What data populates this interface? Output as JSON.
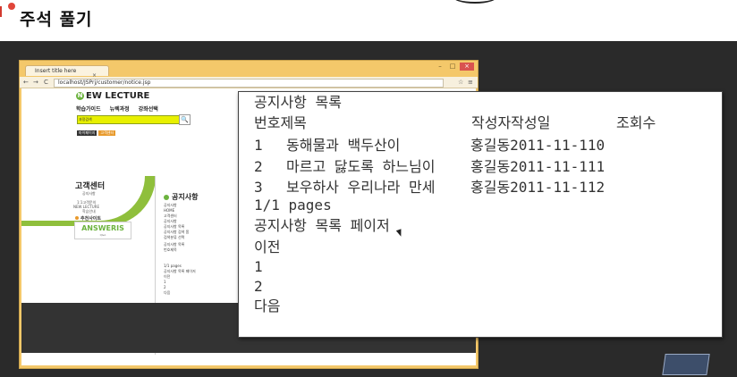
{
  "slide": {
    "title": "주석 풀기"
  },
  "browser": {
    "tab_title": "Insert title here",
    "tab_close": "×",
    "url": "localhost/JSPrj/customer/notice.jsp",
    "window_buttons": [
      "–",
      "□",
      "×"
    ],
    "nav_icons": [
      "←",
      "→",
      "C"
    ],
    "tool_icons": [
      "☆",
      "≡"
    ]
  },
  "site": {
    "logo_letter": "N",
    "logo_text": "EW LECTURE",
    "nav": [
      "학습가이드",
      "뉴렉과정",
      "강좌선택"
    ],
    "search_label": "과정검색",
    "search_icon": "🔍",
    "mini_buttons": [
      "마이페이지",
      "고객센터"
    ],
    "sidebar_title": "고객센터",
    "sidebar_links": [
      "공지사항",
      "1:1고객문의",
      "NEW LECTURE",
      "학습안내"
    ],
    "recommended": "추천사이트",
    "partner_logo": "ANSWERIS",
    "notice_heading": "공지사항",
    "small_lines": [
      "공지사항",
      "HOME",
      "고객센터",
      "공지사항",
      "공지사항 목록",
      "공지사항 검색 폼",
      "검색분류 선택",
      "공지사항 목록",
      "번호제목",
      "1/1 pages",
      "공지사항 목록 페이저",
      "이전",
      "1",
      "2",
      "다음"
    ]
  },
  "popup": {
    "title": "공지사항 목록",
    "header": {
      "num_title": "번호제목",
      "author_date": "작성자작성일",
      "views": "조회수"
    },
    "rows": [
      {
        "num": "1",
        "title": "동해물과 백두산이",
        "author_date": "홍길동2011-11-110"
      },
      {
        "num": "2",
        "title": "마르고 닳도록 하느님이",
        "author_date": "홍길동2011-11-111"
      },
      {
        "num": "3",
        "title": "보우하사 우리나라 만세",
        "author_date": "홍길동2011-11-112"
      }
    ],
    "pages": "1/1 pages",
    "pager_title": "공지사항 목록 페이저",
    "prev": "이전",
    "page_1": "1",
    "page_2": "2",
    "next": "다음"
  },
  "colors": {
    "browser_frame": "#f4c86a",
    "accent_green": "#8fbf3c",
    "search_yellow": "#e8f000",
    "bullet_red": "#e0453a"
  }
}
